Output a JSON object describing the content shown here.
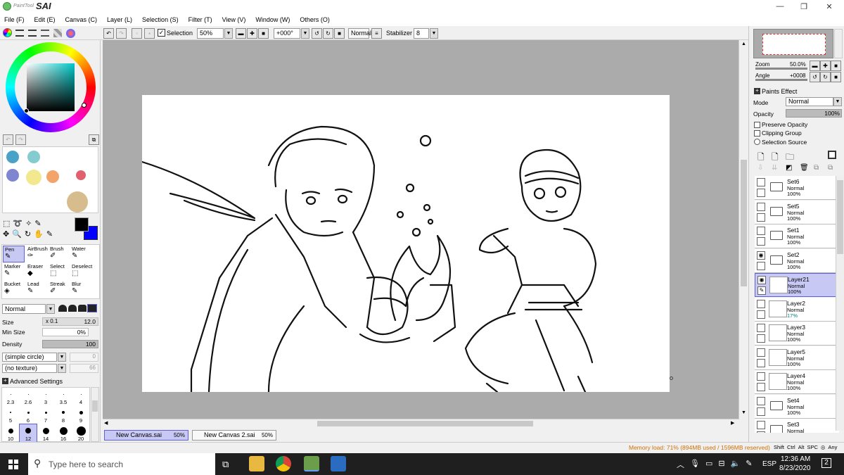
{
  "app": {
    "logo_small": "PaintTool",
    "logo_big": "SAI"
  },
  "window_controls": {
    "minimize": "—",
    "maximize": "❐",
    "close": "✕"
  },
  "menu": [
    "File (F)",
    "Edit (E)",
    "Canvas (C)",
    "Layer (L)",
    "Selection (S)",
    "Filter (T)",
    "View (V)",
    "Window (W)",
    "Others (O)"
  ],
  "toolbar": {
    "selection_label": "Selection",
    "selection_checked": true,
    "zoom_value": "50%",
    "angle_value": "+000°",
    "blend_mode": "Normal",
    "stabilizer_label": "Stabilizer",
    "stabilizer_value": "8"
  },
  "swatches": [
    {
      "color": "#4aa3c6"
    },
    {
      "color": "#84ccd0"
    },
    {
      "color": "#7f86d1"
    },
    {
      "color": "#f2e98e"
    },
    {
      "color": "#f3a46a"
    },
    {
      "color": "#e06070"
    },
    {
      "color": "#d7bc8e"
    }
  ],
  "colors": {
    "primary": "#000000",
    "secondary": "#0000ff"
  },
  "tools": [
    [
      "Pen",
      "AirBrush",
      "Brush",
      "Water"
    ],
    [
      "Marker",
      "Eraser",
      "Select",
      "Deselect"
    ],
    [
      "Bucket",
      "Lead",
      "Streak",
      "Blur"
    ]
  ],
  "brush": {
    "mode": "Normal",
    "size_label": "Size",
    "size_mult": "x 0.1",
    "size_value": "12.0",
    "minsize_label": "Min Size",
    "minsize_value": "0%",
    "density_label": "Density",
    "density_value": "100",
    "shape": "(simple circle)",
    "shape_value": "0",
    "texture": "(no texture)",
    "texture_value": "66",
    "advanced_label": "Advanced Settings"
  },
  "brush_sizes": [
    [
      "2.3",
      "2.6",
      "3",
      "3.5",
      "4"
    ],
    [
      "5",
      "6",
      "7",
      "8",
      "9"
    ],
    [
      "10",
      "12",
      "14",
      "16",
      "20"
    ]
  ],
  "tabs": [
    {
      "name": "New Canvas.sai",
      "zoom": "50%",
      "active": true
    },
    {
      "name": "New Canvas 2.sai",
      "zoom": "50%",
      "active": false
    }
  ],
  "navigator": {
    "zoom_label": "Zoom",
    "zoom_value": "50.0%",
    "angle_label": "Angle",
    "angle_value": "+0008"
  },
  "layer_props": {
    "paints_effect": "Paints Effect",
    "mode_label": "Mode",
    "mode_value": "Normal",
    "opacity_label": "Opacity",
    "opacity_value": "100%",
    "preserve_opacity": "Preserve Opacity",
    "clipping_group": "Clipping Group",
    "selection_source": "Selection Source"
  },
  "layers": [
    {
      "name": "Set6",
      "mode": "Normal",
      "opacity": "100%",
      "type": "folder",
      "visible": false,
      "selected": false
    },
    {
      "name": "Set5",
      "mode": "Normal",
      "opacity": "100%",
      "type": "folder",
      "visible": false,
      "selected": false
    },
    {
      "name": "Set1",
      "mode": "Normal",
      "opacity": "100%",
      "type": "folder",
      "visible": false,
      "selected": false
    },
    {
      "name": "Set2",
      "mode": "Normal",
      "opacity": "100%",
      "type": "folder",
      "visible": true,
      "selected": false
    },
    {
      "name": "Layer21",
      "mode": "Normal",
      "opacity": "100%",
      "type": "layer",
      "visible": true,
      "selected": true
    },
    {
      "name": "Layer2",
      "mode": "Normal",
      "opacity": "17%",
      "type": "layer",
      "visible": false,
      "selected": false
    },
    {
      "name": "Layer3",
      "mode": "Normal",
      "opacity": "100%",
      "type": "layer",
      "visible": false,
      "selected": false
    },
    {
      "name": "Layer5",
      "mode": "Normal",
      "opacity": "100%",
      "type": "layer",
      "visible": false,
      "selected": false
    },
    {
      "name": "Layer4",
      "mode": "Normal",
      "opacity": "100%",
      "type": "layer",
      "visible": false,
      "selected": false
    },
    {
      "name": "Set4",
      "mode": "Normal",
      "opacity": "100%",
      "type": "folder",
      "visible": false,
      "selected": false
    },
    {
      "name": "Set3",
      "mode": "Normal",
      "opacity": "",
      "type": "folder",
      "visible": false,
      "selected": false
    }
  ],
  "status": {
    "memory": "Memory load: 71% (894MB used / 1596MB reserved)",
    "keys": [
      "Shift",
      "Ctrl",
      "Alt",
      "SPC",
      "◎",
      "Any"
    ]
  },
  "taskbar": {
    "search_placeholder": "Type here to search",
    "language": "ESP",
    "time": "12:36 AM",
    "date": "8/23/2020",
    "notification_count": "2"
  }
}
